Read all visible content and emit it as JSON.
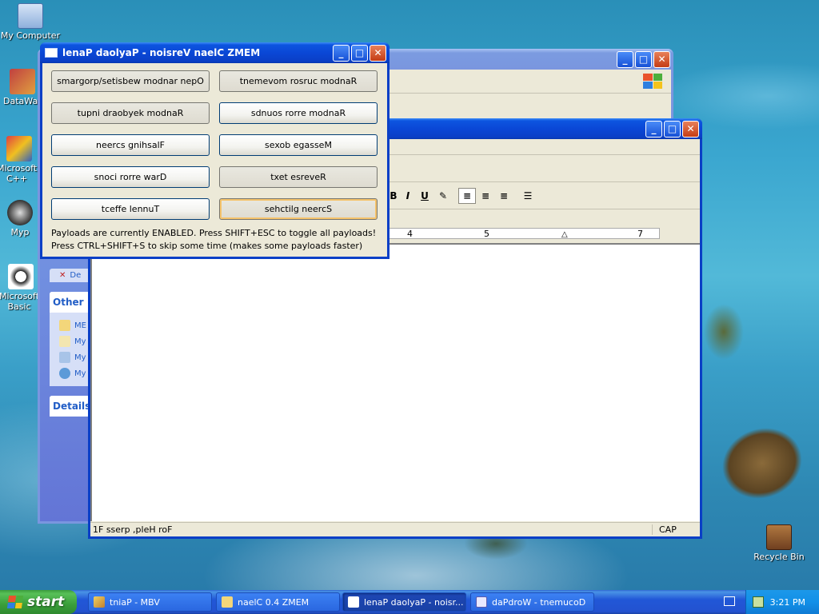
{
  "desktop": {
    "icons": [
      {
        "label": "My Computer"
      },
      {
        "label": "DataWag"
      },
      {
        "label": "Microsoft C++"
      },
      {
        "label": "Myp"
      },
      {
        "label": "Microsoft Basic"
      },
      {
        "label": "Recycle Bin"
      }
    ]
  },
  "explorer_window": {
    "tasks": {
      "partial_item": "De",
      "other_places_title": "Other",
      "other_items": [
        "ME",
        "My",
        "My",
        "My"
      ],
      "details_title": "Details"
    }
  },
  "wordpad_window": {
    "ruler_numbers": [
      "4",
      "5",
      "7"
    ],
    "status_text": "1F sserp ,pleH roF",
    "status_cap": "CAP",
    "format_buttons": [
      "B",
      "I",
      "U"
    ]
  },
  "memz_window": {
    "title": "lenaP daolyaP - noisreV naelC ZMEM",
    "buttons": [
      {
        "label": "smargorp/setisbew modnar nepO"
      },
      {
        "label": "tnemevom rosruc modnaR"
      },
      {
        "label": "tupni draobyek modnaR"
      },
      {
        "label": "sdnuos rorre modnaR"
      },
      {
        "label": "neercs gnihsalF"
      },
      {
        "label": "sexob egasseM"
      },
      {
        "label": "snoci rorre warD"
      },
      {
        "label": "txet esreveR"
      },
      {
        "label": "tceffe lennuT"
      },
      {
        "label": "sehctilg neercS"
      }
    ],
    "info_line1": "Payloads are currently ENABLED. Press SHIFT+ESC to toggle all payloads!",
    "info_line2": "Press CTRL+SHIFT+S to skip some time (makes some payloads faster)"
  },
  "taskbar": {
    "start_label": "start",
    "tasks": [
      {
        "label": "tniaP - MBV"
      },
      {
        "label": "naelC 0.4 ZMEM"
      },
      {
        "label": "lenaP daolyaP - noisr..."
      },
      {
        "label": "daPdroW - tnemucoD"
      }
    ],
    "clock": "3:21 PM"
  }
}
